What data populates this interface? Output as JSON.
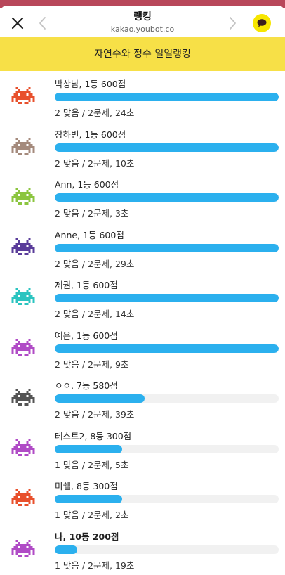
{
  "header": {
    "title": "랭킹",
    "url": "kakao.youbot.co"
  },
  "banner": {
    "text": "자연수와 정수 일일랭킹"
  },
  "colors": {
    "accent_yellow": "#f7e047",
    "bar_blue": "#2bb0ee",
    "kakao_yellow": "#f7e600"
  },
  "ranking": [
    {
      "name_line": "박상남, 1등 600점",
      "stats": "2 맞음 / 2문제, 24초",
      "progress": 1.0,
      "icon": "red-space-invader-icon",
      "color": "#e8502c",
      "me": false
    },
    {
      "name_line": "장하빈, 1등 600점",
      "stats": "2 맞음 / 2문제, 10초",
      "progress": 1.0,
      "icon": "brown-space-invader-icon",
      "color": "#a48a7c",
      "me": false
    },
    {
      "name_line": "Ann, 1등 600점",
      "stats": "2 맞음 / 2문제, 3초",
      "progress": 1.0,
      "icon": "green-space-invader-icon",
      "color": "#8bc53f",
      "me": false
    },
    {
      "name_line": "Anne, 1등 600점",
      "stats": "2 맞음 / 2문제, 29초",
      "progress": 1.0,
      "icon": "purple-space-invader-icon",
      "color": "#5a3c9a",
      "me": false
    },
    {
      "name_line": "제권, 1등 600점",
      "stats": "2 맞음 / 2문제, 14초",
      "progress": 1.0,
      "icon": "teal-space-invader-icon",
      "color": "#2bc4c0",
      "me": false
    },
    {
      "name_line": "예은, 1등 600점",
      "stats": "2 맞음 / 2문제, 9초",
      "progress": 1.0,
      "icon": "magenta-space-invader-icon",
      "color": "#b04bc6",
      "me": false
    },
    {
      "name_line": "ㅇㅇ, 7등 580점",
      "stats": "2 맞음 / 2문제, 39초",
      "progress": 0.4,
      "icon": "gray-space-invader-icon",
      "color": "#555555",
      "me": false
    },
    {
      "name_line": "테스트2, 8등 300점",
      "stats": "1 맞음 / 2문제, 5초",
      "progress": 0.3,
      "icon": "magenta-space-invader-icon",
      "color": "#b04bc6",
      "me": false
    },
    {
      "name_line": "미쉘, 8등 300점",
      "stats": "1 맞음 / 2문제, 2초",
      "progress": 0.3,
      "icon": "red-space-invader-icon",
      "color": "#e8502c",
      "me": false
    },
    {
      "name_line": "나, 10등 200점",
      "stats": "1 맞음 / 2문제, 19초",
      "progress": 0.1,
      "icon": "magenta-space-invader-icon",
      "color": "#b04bc6",
      "me": true
    }
  ]
}
